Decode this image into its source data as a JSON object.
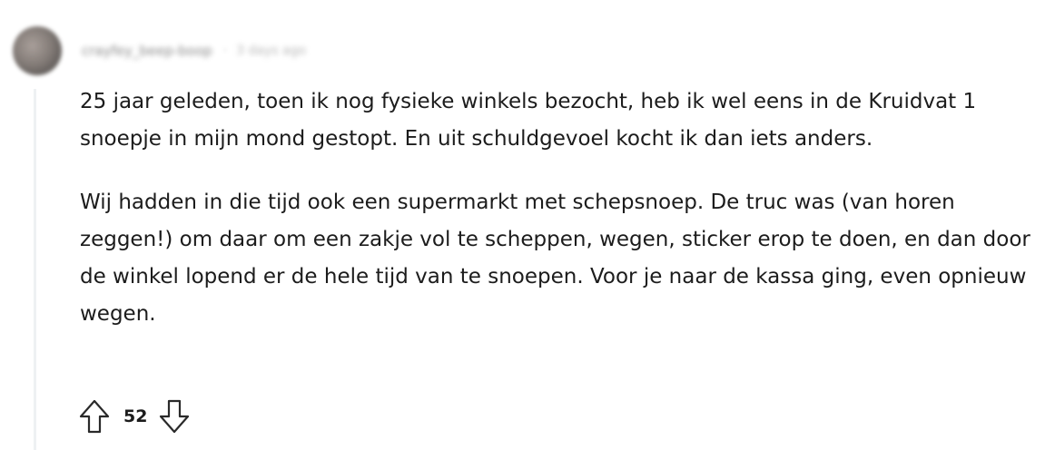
{
  "comment": {
    "author": "crayfey_beep-boop",
    "timestamp": "3 days ago",
    "separator": "·",
    "paragraphs": [
      "25 jaar geleden, toen ik nog fysieke winkels bezocht, heb ik wel eens in de Kruidvat 1 snoepje in mijn mond gestopt. En uit schuldgevoel kocht ik dan iets anders.",
      "Wij hadden in die tijd ook een supermarkt met schepsnoep. De truc was (van horen zeggen!) om daar om een zakje vol te scheppen, wegen, sticker erop te doen, en dan door de winkel lopend er de hele tijd van te snoepen. Voor je naar de kassa ging, even opnieuw wegen."
    ],
    "score": "52",
    "icons": {
      "upvote": "arrow-up-outline-icon",
      "downvote": "arrow-down-outline-icon"
    }
  }
}
